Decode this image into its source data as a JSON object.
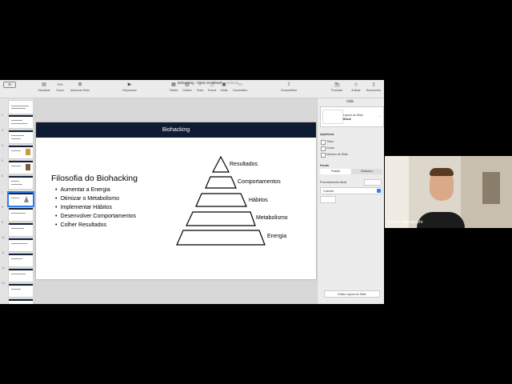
{
  "window": {
    "doc_title": "Biohacking - Curso Dr Mibisef",
    "edited": "— Editado",
    "sidebar_button": "⊞",
    "toolbar": [
      {
        "label": "Visualizar",
        "icon": "view-icon"
      },
      {
        "label": "Zoom",
        "icon": "zoom-icon",
        "value": "78%"
      },
      {
        "label": "Adicionar Slide",
        "icon": "add-slide-icon"
      },
      {
        "label": "Reproduzir",
        "icon": "play-icon"
      },
      {
        "label": "Tabela",
        "icon": "table-icon"
      },
      {
        "label": "Gráfico",
        "icon": "chart-icon"
      },
      {
        "label": "Texto",
        "icon": "text-icon"
      },
      {
        "label": "Forma",
        "icon": "shape-icon"
      },
      {
        "label": "Mídia",
        "icon": "media-icon"
      },
      {
        "label": "Comentário",
        "icon": "comment-icon"
      },
      {
        "label": "Compartilhar",
        "icon": "share-icon"
      },
      {
        "label": "Formatar",
        "icon": "format-icon"
      },
      {
        "label": "Animar",
        "icon": "animate-icon"
      },
      {
        "label": "Documento",
        "icon": "document-icon"
      }
    ]
  },
  "navigator": {
    "slide_numbers": [
      "1",
      "2",
      "3",
      "4",
      "5",
      "6",
      "7",
      "8",
      "9",
      "10",
      "11",
      "12",
      "13"
    ],
    "selected_index": 6
  },
  "slide": {
    "header": "Biohacking",
    "heading": "Filosofia do Biohacking",
    "bullets": [
      "Aumentar a Energia",
      "Otimizar o Metabolismo",
      "Implementar Hábitos",
      "Desenvolver Comportamentos",
      "Colher Resultados"
    ],
    "pyramid_labels": [
      "Resultados",
      "Comportamentos",
      "Hábitos",
      "Metabolismo",
      "Energia"
    ]
  },
  "inspector": {
    "tab": "Slide",
    "layout_label": "Layout do Slide",
    "layout_value": "Blank",
    "appearance_heading": "Aparência",
    "options": [
      "Título",
      "Corpo",
      "Número de Slide"
    ],
    "background_heading": "Fundo",
    "bg_tabs": [
      "Padrão",
      "Dinâmico"
    ],
    "fill_label": "Preenchimento Atual",
    "fill_value": "Colorido",
    "edit_layout_button": "Editar Layout do Slide"
  },
  "camera": {
    "name": "Sergio Yamaguchi"
  },
  "colors": {
    "slide_header_bg": "#0f1b33",
    "selection": "#2f7ef0"
  }
}
